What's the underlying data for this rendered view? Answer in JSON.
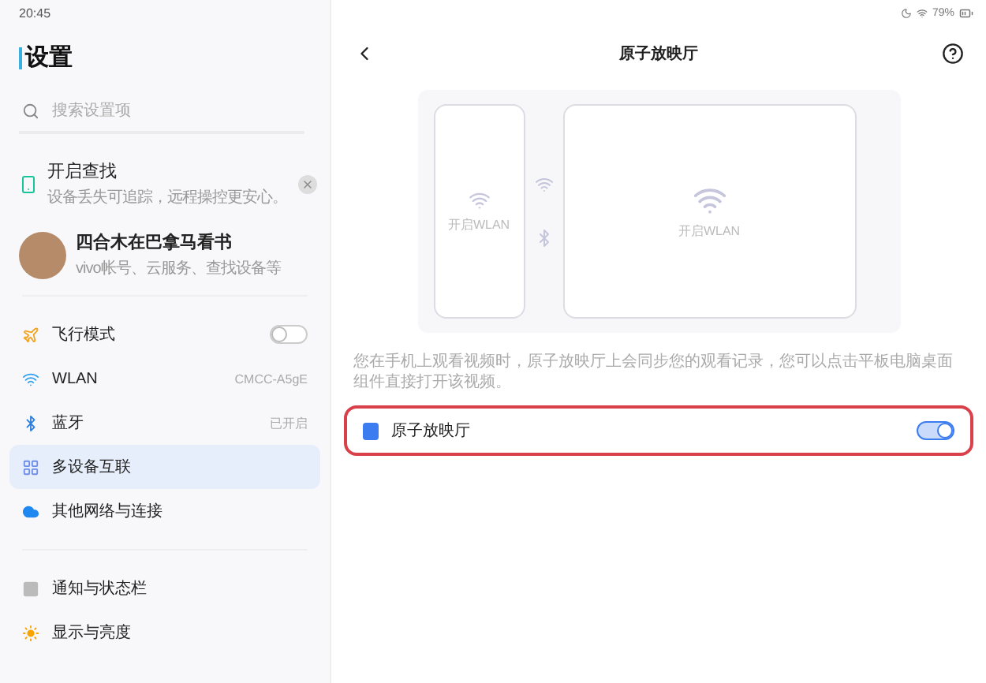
{
  "status_bar": {
    "time": "20:45",
    "battery": "79%"
  },
  "sidebar": {
    "title": "设置",
    "search": {
      "placeholder": "搜索设置项"
    },
    "find_card": {
      "title": "开启查找",
      "subtitle": "设备丢失可追踪，远程操控更安心。"
    },
    "account": {
      "name": "四合木在巴拿马看书",
      "subtitle": "vivo帐号、云服务、查找设备等"
    },
    "groups": [
      [
        {
          "label": "飞行模式",
          "kind": "toggle",
          "on": false,
          "selected": false
        },
        {
          "label": "WLAN",
          "kind": "value",
          "value": "CMCC-A5gE",
          "selected": false
        },
        {
          "label": "蓝牙",
          "kind": "value",
          "value": "已开启",
          "selected": false
        },
        {
          "label": "多设备互联",
          "kind": "link",
          "selected": true
        },
        {
          "label": "其他网络与连接",
          "kind": "link",
          "selected": false
        }
      ],
      [
        {
          "label": "通知与状态栏",
          "kind": "link",
          "selected": false
        },
        {
          "label": "显示与亮度",
          "kind": "link",
          "selected": false
        }
      ]
    ]
  },
  "page": {
    "title": "原子放映厅",
    "illustration": {
      "phone_label": "开启WLAN",
      "tablet_label": "开启WLAN"
    },
    "description": "您在手机上观看视频时，原子放映厅上会同步您的观看记录，您可以点击平板电脑桌面组件直接打开该视频。",
    "setting": {
      "label": "原子放映厅",
      "on": true,
      "highlighted": true
    }
  }
}
